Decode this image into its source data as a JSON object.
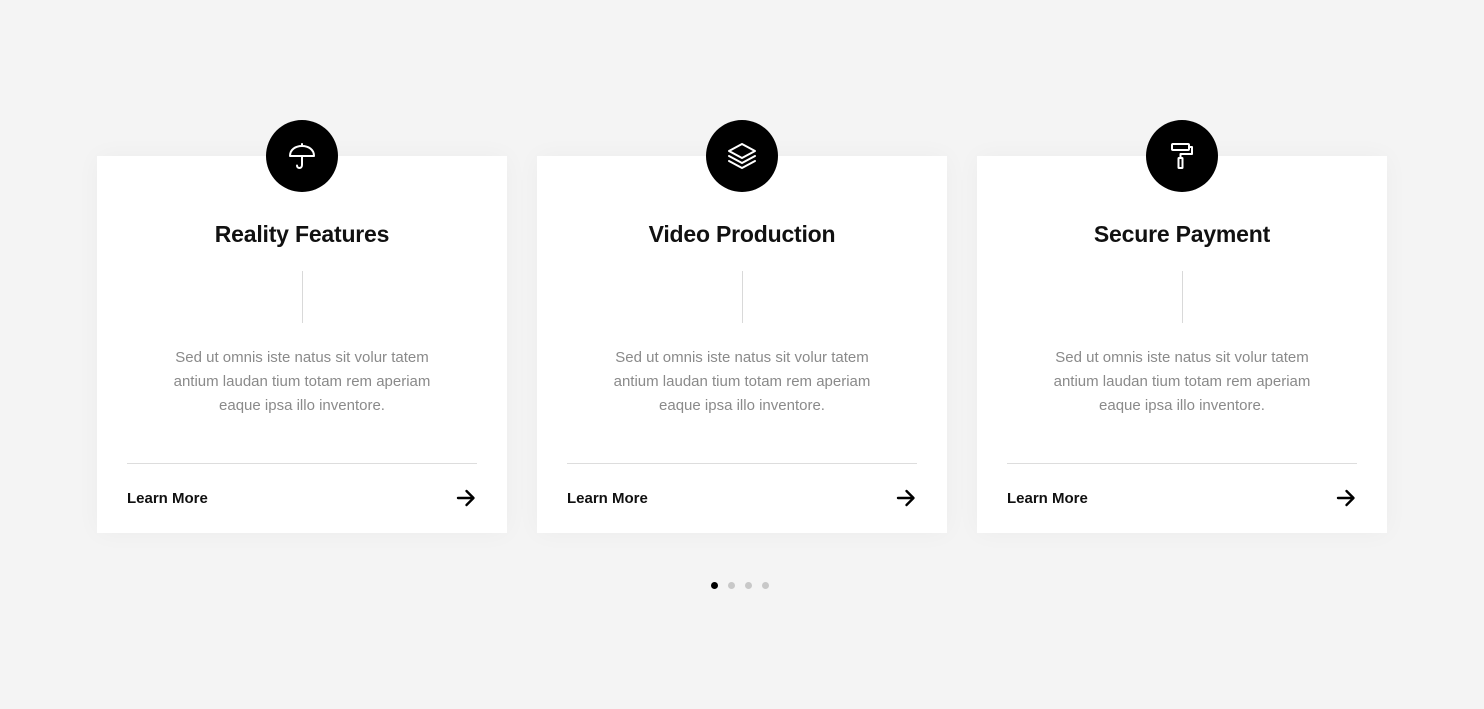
{
  "colors": {
    "background": "#f4f4f4",
    "card": "#ffffff",
    "accent": "#000000",
    "title": "#111111",
    "description": "#8a8a8a",
    "dot_inactive": "#c8c8c8"
  },
  "cards": [
    {
      "icon": "umbrella-icon",
      "title": "Reality Features",
      "description": "Sed ut omnis iste natus sit volur tatem antium laudan tium totam rem aperiam eaque ipsa illo inventore.",
      "link_label": "Learn More",
      "link_icon": "arrow-right-icon"
    },
    {
      "icon": "layers-icon",
      "title": "Video Production",
      "description": "Sed ut omnis iste natus sit volur tatem antium laudan tium totam rem aperiam eaque ipsa illo inventore.",
      "link_label": "Learn More",
      "link_icon": "arrow-right-icon"
    },
    {
      "icon": "paint-roller-icon",
      "title": "Secure Payment",
      "description": "Sed ut omnis iste natus sit volur tatem antium laudan tium totam rem aperiam eaque ipsa illo inventore.",
      "link_label": "Learn More",
      "link_icon": "arrow-right-icon"
    }
  ],
  "pagination": {
    "total": 4,
    "active": 1
  }
}
